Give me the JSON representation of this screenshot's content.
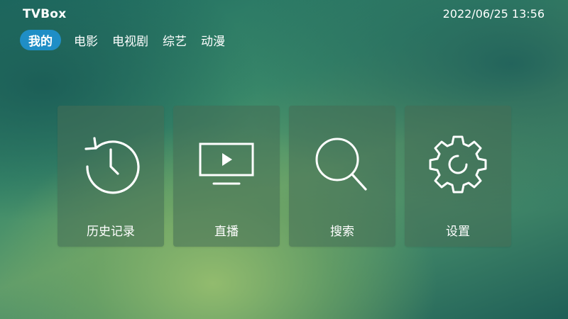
{
  "app": {
    "title": "TVBox"
  },
  "clock": {
    "datetime": "2022/06/25 13:56"
  },
  "tabs": [
    {
      "label": "我的",
      "active": true
    },
    {
      "label": "电影",
      "active": false
    },
    {
      "label": "电视剧",
      "active": false
    },
    {
      "label": "综艺",
      "active": false
    },
    {
      "label": "动漫",
      "active": false
    }
  ],
  "cards": [
    {
      "label": "历史记录",
      "icon": "history-icon"
    },
    {
      "label": "直播",
      "icon": "live-tv-icon"
    },
    {
      "label": "搜索",
      "icon": "search-icon"
    },
    {
      "label": "设置",
      "icon": "settings-gear-icon"
    }
  ],
  "colors": {
    "tab_active_bg": "#1f8ec6",
    "card_bg": "rgba(70,110,85,0.55)",
    "icon_stroke": "#ffffff"
  }
}
